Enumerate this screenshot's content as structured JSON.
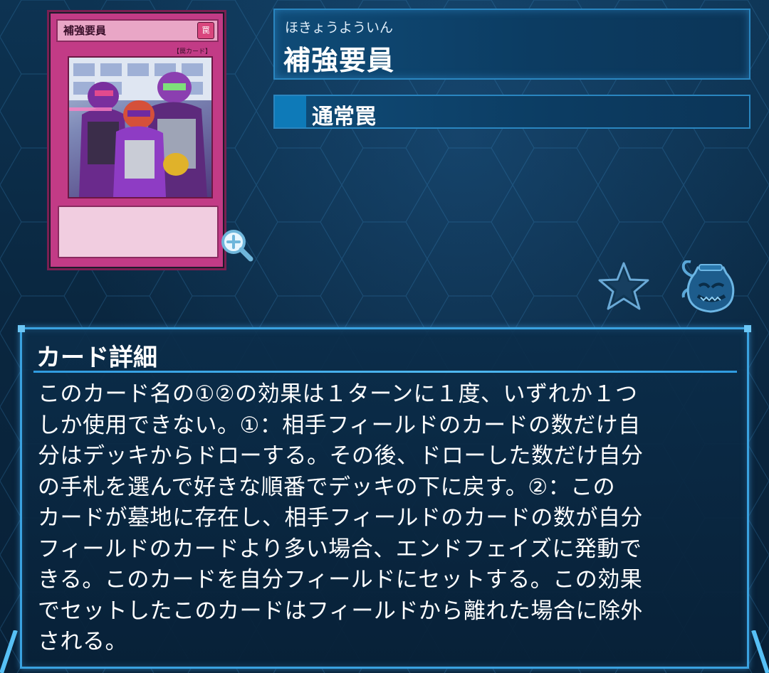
{
  "card": {
    "name_on_card": "補強要員",
    "attribute_icon": "罠",
    "type_on_card": "【罠カード】",
    "zoom_icon": "zoom-in-icon"
  },
  "header": {
    "reading": "ほきょうよういん",
    "name": "補強要員"
  },
  "type_panel": {
    "label": "通常罠"
  },
  "icons": {
    "favorite": "star-icon",
    "character": "pot-of-greed-icon"
  },
  "details": {
    "heading": "カード詳細",
    "text": "このカード名の①②の効果は１ターンに１度、いずれか１つ\nしか使用できない。①：相手フィールドのカードの数だけ自\n分はデッキからドローする。その後、ドローした数だけ自分\nの手札を選んで好きな順番でデッキの下に戻す。②：この\nカードが墓地に存在し、相手フィールドのカードの数が自分\nフィールドのカードより多い場合、エンドフェイズに発動で\nきる。このカードを自分フィールドにセットする。この効果\nでセットしたこのカードはフィールドから離れた場合に除外\nされる。"
  },
  "colors": {
    "accent": "#3aa2e0",
    "trap_card": "#c23b86",
    "background": "#0a2a44"
  }
}
